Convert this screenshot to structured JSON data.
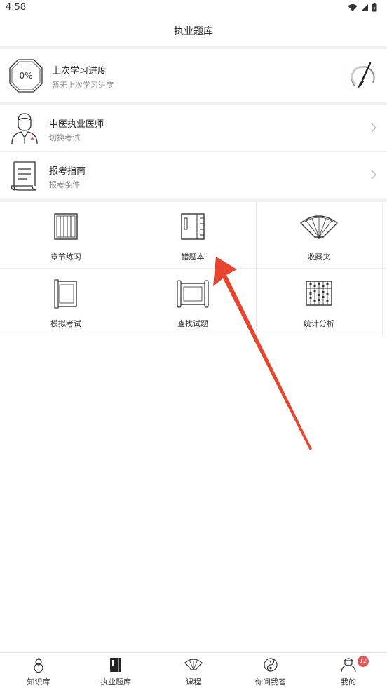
{
  "status": {
    "time": "4:58"
  },
  "header": {
    "title": "执业题库"
  },
  "progress": {
    "percent": "0%",
    "title": "上次学习进度",
    "subtitle": "暂无上次学习进度"
  },
  "list": [
    {
      "title": "中医执业医师",
      "subtitle": "切换考试"
    },
    {
      "title": "报考指南",
      "subtitle": "报考条件"
    }
  ],
  "grid": [
    {
      "label": "章节练习"
    },
    {
      "label": "错题本"
    },
    {
      "label": "收藏夹"
    },
    {
      "label": "模拟考试"
    },
    {
      "label": "查找试题"
    },
    {
      "label": "统计分析"
    }
  ],
  "tabs": [
    {
      "label": "知识库"
    },
    {
      "label": "执业题库"
    },
    {
      "label": "课程"
    },
    {
      "label": "你问我答"
    },
    {
      "label": "我的",
      "badge": "12"
    }
  ],
  "colors": {
    "arrow": "#e8452f",
    "badge": "#e05a5a"
  }
}
